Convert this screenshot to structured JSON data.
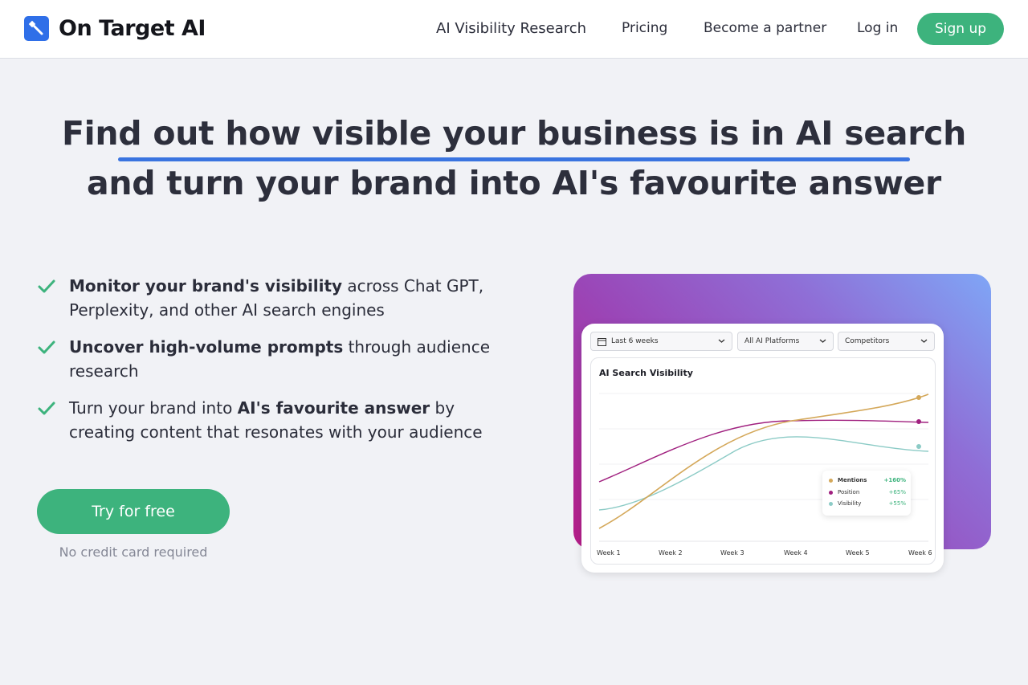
{
  "brand": {
    "name": "On Target AI",
    "logo_icon": "wand-icon",
    "color": "#2f6fe8"
  },
  "nav": {
    "research": "AI Visibility Research",
    "pricing": "Pricing",
    "partner": "Become a partner",
    "login": "Log in",
    "signup": "Sign up"
  },
  "hero": {
    "line1": "Find out how visible your business is in AI search",
    "line2": "and turn your brand into AI's favourite answer"
  },
  "features": [
    {
      "bold": "Monitor your brand's visibility",
      "rest": " across Chat GPT, Perplexity, and other AI search engines"
    },
    {
      "bold": "Uncover high-volume prompts",
      "rest": " through audience research"
    },
    {
      "pre": "Turn your brand into ",
      "bold": "AI's favourite answer",
      "rest": " by creating content that resonates with your audience"
    }
  ],
  "cta": {
    "label": "Try for free",
    "note": "No credit card required"
  },
  "colors": {
    "accent": "#3db37d",
    "underline": "#3a74e0"
  },
  "dashboard": {
    "filters": {
      "period": "Last 6  weeks",
      "platforms": "All AI Platforms",
      "competitors": "Competitors"
    },
    "chart_title": "AI Search Visibility",
    "legend": [
      {
        "name": "Mentions",
        "change": "+160%",
        "color": "#d4a85a"
      },
      {
        "name": "Position",
        "change": "+65%",
        "color": "#a0207f"
      },
      {
        "name": "Visibility",
        "change": "+55%",
        "color": "#8ccbc6"
      }
    ],
    "weeks": [
      "Week 1",
      "Week 2",
      "Week 3",
      "Week 4",
      "Week 5",
      "Week 6"
    ]
  }
}
